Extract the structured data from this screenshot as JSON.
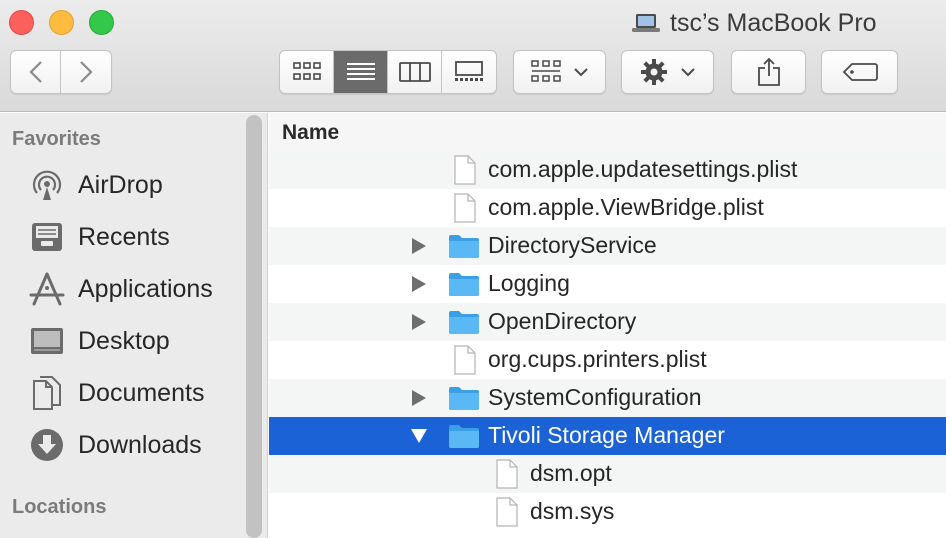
{
  "window": {
    "title": "tsc’s MacBook Pro"
  },
  "toolbar": {
    "nav": {
      "back": "chevron-left-icon",
      "forward": "chevron-right-icon"
    },
    "views": [
      "icon-view",
      "list-view",
      "column-view",
      "gallery-view"
    ],
    "active_view": "list-view",
    "arrange_icon": "arrange-grid-icon",
    "action_icon": "gear-icon",
    "share_icon": "share-icon",
    "tag_icon": "tag-icon"
  },
  "sidebar": {
    "favorites_heading": "Favorites",
    "locations_heading": "Locations",
    "items": [
      {
        "label": "AirDrop",
        "icon": "airdrop-icon"
      },
      {
        "label": "Recents",
        "icon": "recents-icon"
      },
      {
        "label": "Applications",
        "icon": "applications-icon"
      },
      {
        "label": "Desktop",
        "icon": "desktop-icon"
      },
      {
        "label": "Documents",
        "icon": "documents-icon"
      },
      {
        "label": "Downloads",
        "icon": "downloads-icon"
      }
    ]
  },
  "list": {
    "column_name": "Name",
    "rows": [
      {
        "name": "com.apple.updatesettings.plist",
        "kind": "file",
        "level": 0
      },
      {
        "name": "com.apple.ViewBridge.plist",
        "kind": "file",
        "level": 0
      },
      {
        "name": "DirectoryService",
        "kind": "folder",
        "level": 0,
        "expanded": false
      },
      {
        "name": "Logging",
        "kind": "folder",
        "level": 0,
        "expanded": false
      },
      {
        "name": "OpenDirectory",
        "kind": "folder",
        "level": 0,
        "expanded": false
      },
      {
        "name": "org.cups.printers.plist",
        "kind": "file",
        "level": 0
      },
      {
        "name": "SystemConfiguration",
        "kind": "folder",
        "level": 0,
        "expanded": false
      },
      {
        "name": "Tivoli Storage Manager",
        "kind": "folder",
        "level": 0,
        "expanded": true,
        "selected": true
      },
      {
        "name": "dsm.opt",
        "kind": "file",
        "level": 1
      },
      {
        "name": "dsm.sys",
        "kind": "file",
        "level": 1
      }
    ]
  },
  "colors": {
    "selection": "#1b62d6",
    "folder": "#5ab8f5",
    "close": "#fc605c",
    "minimize": "#fdbc40",
    "zoom": "#34c84a"
  }
}
